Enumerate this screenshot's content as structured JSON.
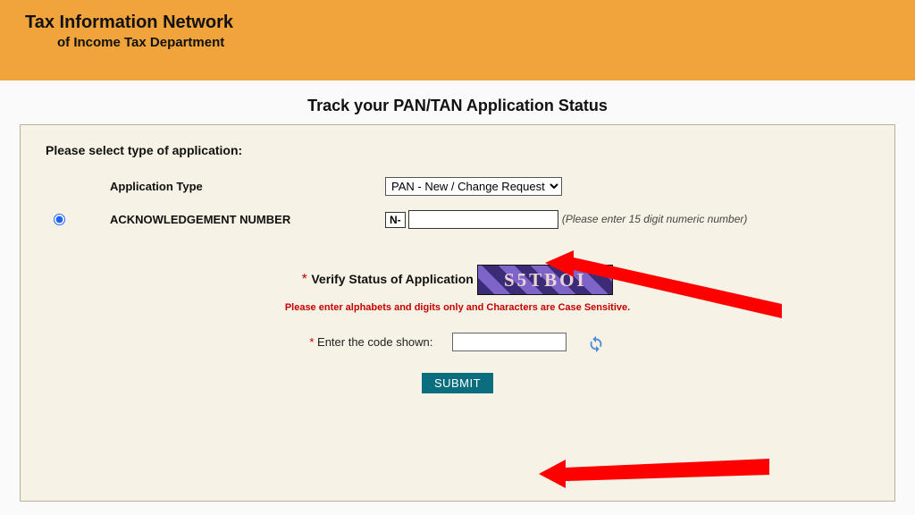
{
  "header": {
    "title": "Tax Information Network",
    "subtitle": "of Income Tax Department"
  },
  "page_title": "Track your PAN/TAN Application Status",
  "form": {
    "instruction": "Please select type of application:",
    "app_type": {
      "label": "Application Type",
      "selected": "PAN - New / Change Request"
    },
    "ack": {
      "label": "ACKNOWLEDGEMENT NUMBER",
      "prefix": "N-",
      "hint": "(Please enter 15 digit numeric number)",
      "value": ""
    },
    "verify_title": "Verify Status of Application",
    "captcha_text": "S5TBOI",
    "captcha_note": "Please enter alphabets and digits only and Characters are Case Sensitive.",
    "code_label": "Enter the code shown:",
    "code_value": "",
    "submit": "SUBMIT"
  }
}
